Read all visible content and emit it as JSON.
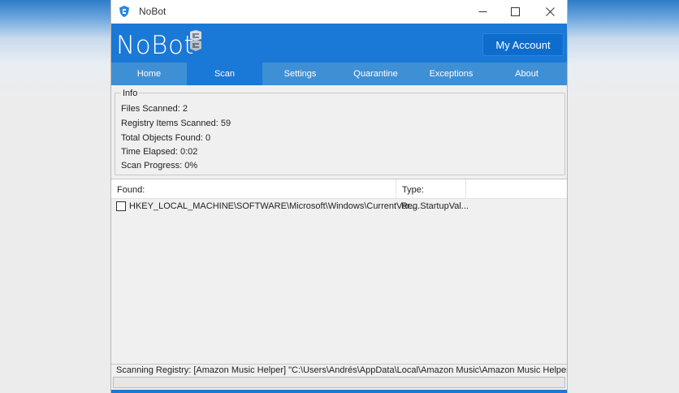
{
  "window": {
    "title": "NoBot"
  },
  "header": {
    "logo": "NoBot",
    "account_label": "My Account"
  },
  "tabs": [
    {
      "label": "Home"
    },
    {
      "label": "Scan",
      "active": true
    },
    {
      "label": "Settings"
    },
    {
      "label": "Quarantine"
    },
    {
      "label": "Exceptions"
    },
    {
      "label": "About"
    }
  ],
  "info": {
    "legend": "Info",
    "files_scanned": "Files Scanned: 2",
    "registry_items": "Registry Items Scanned: 59",
    "objects_found": "Total Objects Found: 0",
    "time_elapsed": "Time Elapsed: 0:02",
    "scan_progress": "Scan Progress: 0%"
  },
  "results": {
    "col_found": "Found:",
    "col_type": "Type:",
    "rows": [
      {
        "checked": false,
        "found": "HKEY_LOCAL_MACHINE\\SOFTWARE\\Microsoft\\Windows\\CurrentVer...",
        "type": "Reg.StartupVal..."
      }
    ]
  },
  "status_text": "Scanning Registry: [Amazon Music Helper] \"C:\\Users\\Andrés\\AppData\\Local\\Amazon Music\\Amazon Music Helper.exe\"",
  "progress_fraction": 0.0,
  "colors": {
    "header_blue": "#1a78d6",
    "tab_bar": "#3f8fd4",
    "progress_green": "#06b025"
  },
  "icons": {
    "app": "nobot-shield-icon",
    "minimize": "minimize-icon",
    "maximize": "maximize-icon",
    "close": "close-icon"
  }
}
